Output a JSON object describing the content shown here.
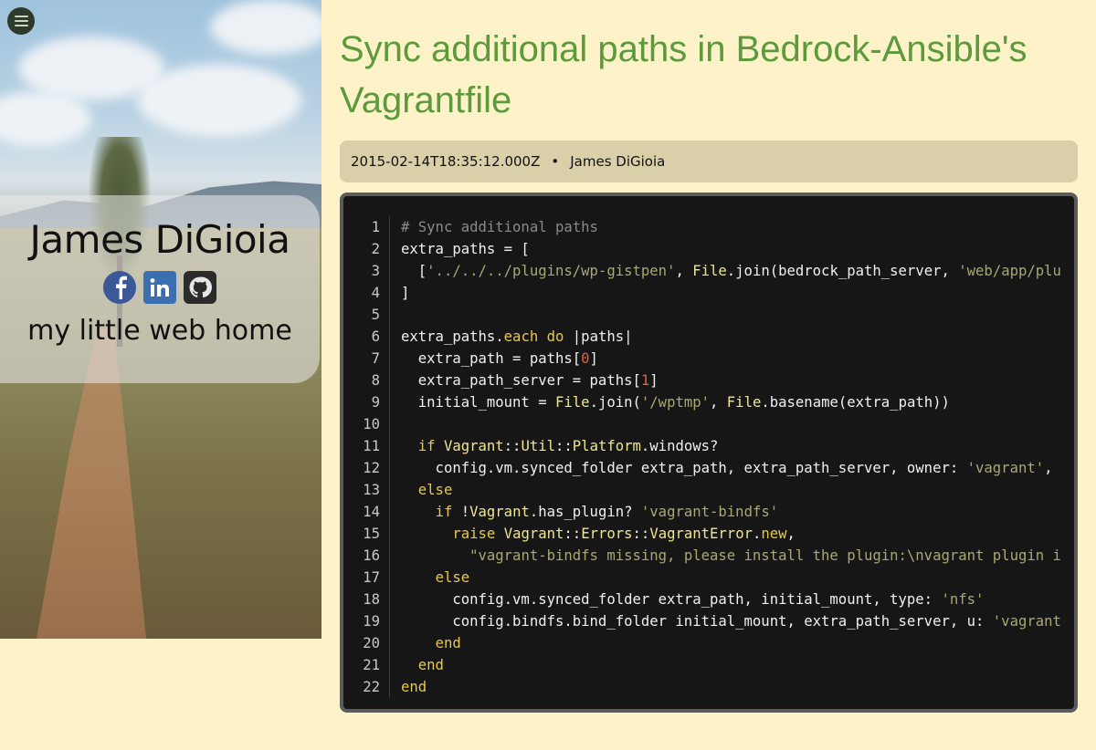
{
  "sidebar": {
    "name": "James DiGioia",
    "tagline": "my little web home",
    "socials": [
      "facebook",
      "linkedin",
      "github"
    ]
  },
  "post": {
    "title": "Sync additional paths in Bedrock-Ansible's Vagrantfile",
    "date": "2015-02-14T18:35:12.000Z",
    "separator": "•",
    "author": "James DiGioia"
  },
  "code": {
    "language": "ruby",
    "lines": [
      "# Sync additional paths",
      "extra_paths = [",
      "  ['../../../plugins/wp-gistpen', File.join(bedrock_path_server, 'web/app/plu",
      "]",
      "",
      "extra_paths.each do |paths|",
      "  extra_path = paths[0]",
      "  extra_path_server = paths[1]",
      "  initial_mount = File.join('/wptmp', File.basename(extra_path))",
      "",
      "  if Vagrant::Util::Platform.windows?",
      "    config.vm.synced_folder extra_path, extra_path_server, owner: 'vagrant', ",
      "  else",
      "    if !Vagrant.has_plugin? 'vagrant-bindfs'",
      "      raise Vagrant::Errors::VagrantError.new,",
      "        \"vagrant-bindfs missing, please install the plugin:\\nvagrant plugin i",
      "    else",
      "      config.vm.synced_folder extra_path, initial_mount, type: 'nfs'",
      "      config.bindfs.bind_folder initial_mount, extra_path_server, u: 'vagrant",
      "    end",
      "  end",
      "end"
    ]
  }
}
